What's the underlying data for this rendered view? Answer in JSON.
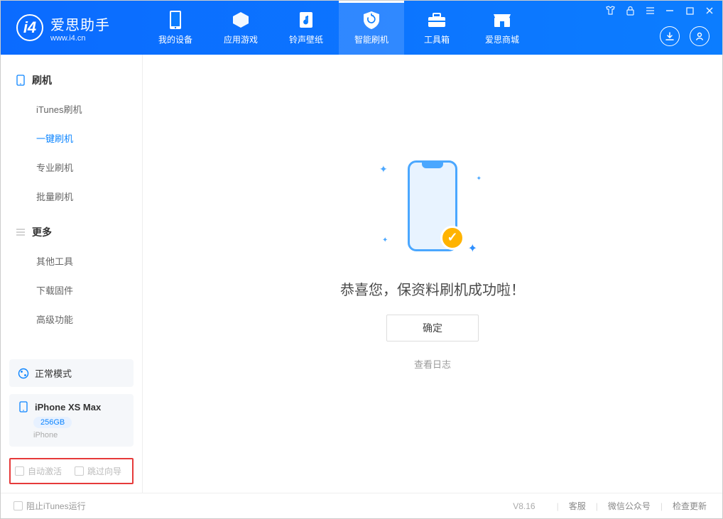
{
  "app": {
    "title": "爱思助手",
    "subtitle": "www.i4.cn"
  },
  "nav": {
    "tabs": [
      {
        "label": "我的设备"
      },
      {
        "label": "应用游戏"
      },
      {
        "label": "铃声壁纸"
      },
      {
        "label": "智能刷机"
      },
      {
        "label": "工具箱"
      },
      {
        "label": "爱思商城"
      }
    ]
  },
  "sidebar": {
    "section1_title": "刷机",
    "items1": [
      {
        "label": "iTunes刷机"
      },
      {
        "label": "一键刷机"
      },
      {
        "label": "专业刷机"
      },
      {
        "label": "批量刷机"
      }
    ],
    "section2_title": "更多",
    "items2": [
      {
        "label": "其他工具"
      },
      {
        "label": "下载固件"
      },
      {
        "label": "高级功能"
      }
    ],
    "mode_label": "正常模式",
    "device": {
      "name": "iPhone XS Max",
      "storage": "256GB",
      "type": "iPhone"
    },
    "auto_activate": "自动激活",
    "skip_guide": "跳过向导"
  },
  "main": {
    "success_text": "恭喜您，保资料刷机成功啦！",
    "ok_button": "确定",
    "view_log": "查看日志"
  },
  "footer": {
    "block_itunes": "阻止iTunes运行",
    "version": "V8.16",
    "links": [
      "客服",
      "微信公众号",
      "检查更新"
    ]
  }
}
